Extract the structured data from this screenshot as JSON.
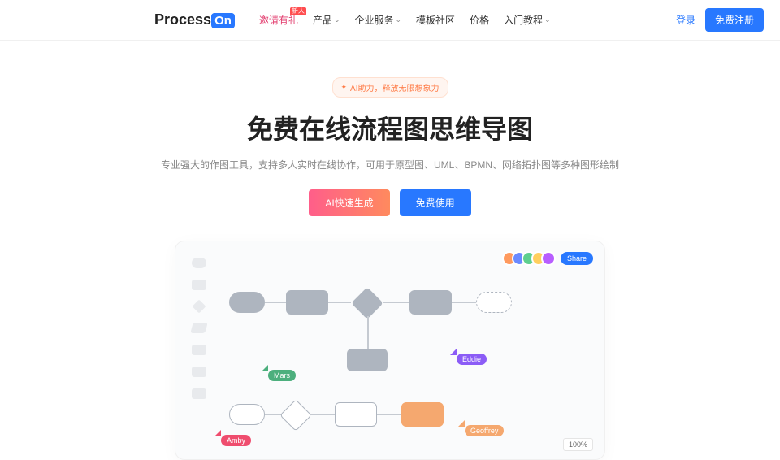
{
  "header": {
    "logo_prefix": "Process",
    "logo_suffix": "On",
    "promo": "邀请有礼",
    "promo_badge": "新人",
    "nav": {
      "product": "产品",
      "enterprise": "企业服务",
      "templates": "模板社区",
      "price": "价格",
      "tutorial": "入门教程"
    },
    "login": "登录",
    "register": "免费注册"
  },
  "hero": {
    "ai_tag": "AI助力，释放无限想象力",
    "title": "免费在线流程图思维导图",
    "subtitle": "专业强大的作图工具，支持多人实时在线协作，可用于原型图、UML、BPMN、网络拓扑图等多种图形绘制",
    "btn_ai": "AI快速生成",
    "btn_free": "免费使用"
  },
  "preview": {
    "share": "Share",
    "cursors": {
      "mars": "Mars",
      "eddie": "Eddie",
      "amby": "Amby",
      "geoffrey": "Geoffrey"
    },
    "zoom": "100%"
  }
}
